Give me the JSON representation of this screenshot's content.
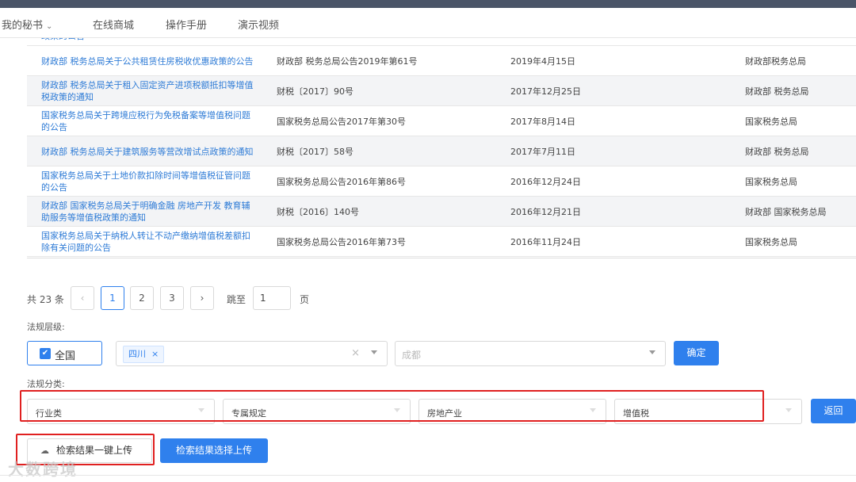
{
  "nav": {
    "items": [
      "我的秘书",
      "在线商城",
      "操作手册",
      "演示视频"
    ]
  },
  "table": {
    "cut_row_text": "政策的公告",
    "rows": [
      {
        "title": "财政部 税务总局关于公共租赁住房税收优惠政策的公告",
        "doc": "财政部 税务总局公告2019年第61号",
        "date": "2019年4月15日",
        "org": "财政部税务总局"
      },
      {
        "title": "财政部 税务总局关于租入固定资产进项税额抵扣等增值税政策的通知",
        "doc": "财税〔2017〕90号",
        "date": "2017年12月25日",
        "org": "财政部 税务总局"
      },
      {
        "title": "国家税务总局关于跨境应税行为免税备案等增值税问题的公告",
        "doc": "国家税务总局公告2017年第30号",
        "date": "2017年8月14日",
        "org": "国家税务总局"
      },
      {
        "title": "财政部 税务总局关于建筑服务等营改增试点政策的通知",
        "doc": "财税〔2017〕58号",
        "date": "2017年7月11日",
        "org": "财政部 税务总局"
      },
      {
        "title": "国家税务总局关于土地价款扣除时间等增值税征管问题的公告",
        "doc": "国家税务总局公告2016年第86号",
        "date": "2016年12月24日",
        "org": "国家税务总局"
      },
      {
        "title": "财政部 国家税务总局关于明确金融 房地产开发 教育辅助服务等增值税政策的通知",
        "doc": "财税〔2016〕140号",
        "date": "2016年12月21日",
        "org": "财政部 国家税务总局"
      },
      {
        "title": "国家税务总局关于纳税人转让不动产缴纳增值税差额扣除有关问题的公告",
        "doc": "国家税务总局公告2016年第73号",
        "date": "2016年11月24日",
        "org": "国家税务总局"
      }
    ]
  },
  "pagination": {
    "total": "共 23 条",
    "prev": "‹",
    "pages": [
      "1",
      "2",
      "3"
    ],
    "current": "1",
    "next": "›",
    "goto_label": "跳至",
    "goto_value": "1",
    "page_unit": "页"
  },
  "filters": {
    "level_label": "法规层级:",
    "national_checkbox": "全国",
    "national_checked": true,
    "province_tag": "四川",
    "city_placeholder": "成都",
    "confirm_button": "确定",
    "category_label": "法规分类:",
    "categories": [
      "行业类",
      "专属规定",
      "房地产业",
      "增值税"
    ],
    "back_button": "返回"
  },
  "actions": {
    "upload_all_button": "检索结果一键上传",
    "upload_selected_button": "检索结果选择上传"
  },
  "watermark": "大数跨境",
  "colors": {
    "primary": "#2f80ed",
    "link": "#2e7bd6",
    "highlight_box": "#e02020"
  }
}
